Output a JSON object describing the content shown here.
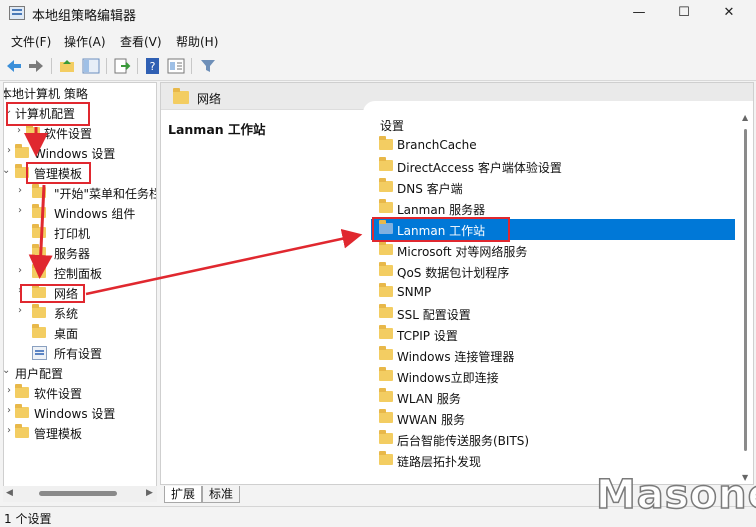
{
  "window": {
    "title": "本地组策略编辑器",
    "minimize": "—",
    "maximize": "☐",
    "close": "✕"
  },
  "menu": [
    "文件(F)",
    "操作(A)",
    "查看(V)",
    "帮助(H)"
  ],
  "tree": {
    "root": "本地计算机 策略",
    "computer_config": "计算机配置",
    "software_settings": "软件设置",
    "windows_settings": "Windows 设置",
    "admin_templates": "管理模板",
    "start_menu": "\"开始\"菜单和任务栏",
    "windows_components": "Windows 组件",
    "printers": "打印机",
    "server": "服务器",
    "control_panel": "控制面板",
    "network": "网络",
    "system": "系统",
    "desktop": "桌面",
    "all_settings": "所有设置",
    "user_config": "用户配置",
    "user_software_settings": "软件设置",
    "user_windows_settings": "Windows 设置",
    "user_admin_templates": "管理模板"
  },
  "right_pane": {
    "header": "网络",
    "description_title": "Lanman 工作站",
    "column_header": "设置",
    "items": [
      "BranchCache",
      "DirectAccess 客户端体验设置",
      "DNS 客户端",
      "Lanman 服务器",
      "Lanman 工作站",
      "Microsoft 对等网络服务",
      "QoS 数据包计划程序",
      "SNMP",
      "SSL 配置设置",
      "TCPIP 设置",
      "Windows 连接管理器",
      "Windows立即连接",
      "WLAN 服务",
      "WWAN 服务",
      "后台智能传送服务(BITS)",
      "链路层拓扑发现"
    ]
  },
  "tabs": [
    "扩展",
    "标准"
  ],
  "status": "1 个设置",
  "watermark": "Masone",
  "colors": {
    "selected": "#0078d7",
    "annotation": "#e0282f",
    "folder": "#f3cd62"
  }
}
